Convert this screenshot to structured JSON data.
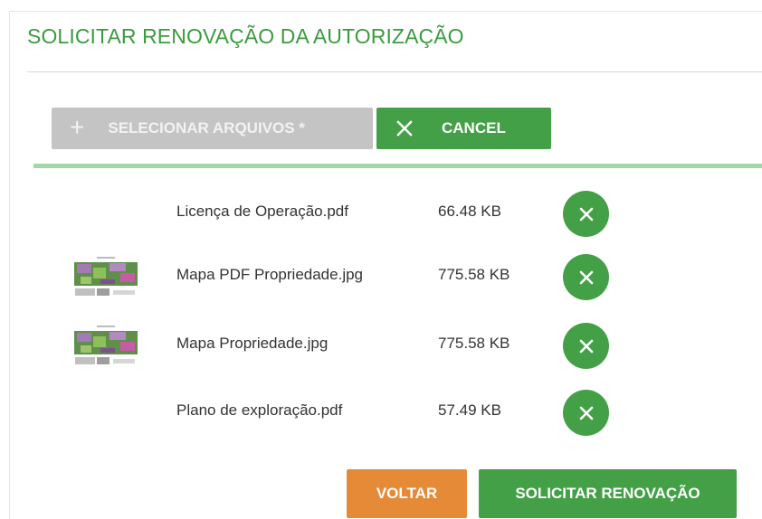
{
  "dialog": {
    "title": "SOLICITAR RENOVAÇÃO DA AUTORIZAÇÃO"
  },
  "toolbar": {
    "select_label": "SELECIONAR ARQUIVOS *",
    "select_icon": "plus-icon",
    "cancel_label": "CANCEL",
    "cancel_icon": "close-icon"
  },
  "upload_progress": 1.0,
  "files": [
    {
      "name": "Licença de Operação.pdf",
      "size": "66.48 KB",
      "has_thumbnail": false
    },
    {
      "name": "Mapa PDF Propriedade.jpg",
      "size": "775.58 KB",
      "has_thumbnail": true
    },
    {
      "name": "Mapa Propriedade.jpg",
      "size": "775.58 KB",
      "has_thumbnail": true
    },
    {
      "name": "Plano de exploração.pdf",
      "size": "57.49 KB",
      "has_thumbnail": false
    }
  ],
  "footer": {
    "back_label": "VOLTAR",
    "submit_label": "SOLICITAR RENOVAÇÃO"
  },
  "colors": {
    "title_green": "#3a9b3e",
    "primary_green": "#43a047",
    "progress_green": "#a5d6a7",
    "disabled_grey": "#c4c4c4",
    "orange": "#e58a37"
  }
}
